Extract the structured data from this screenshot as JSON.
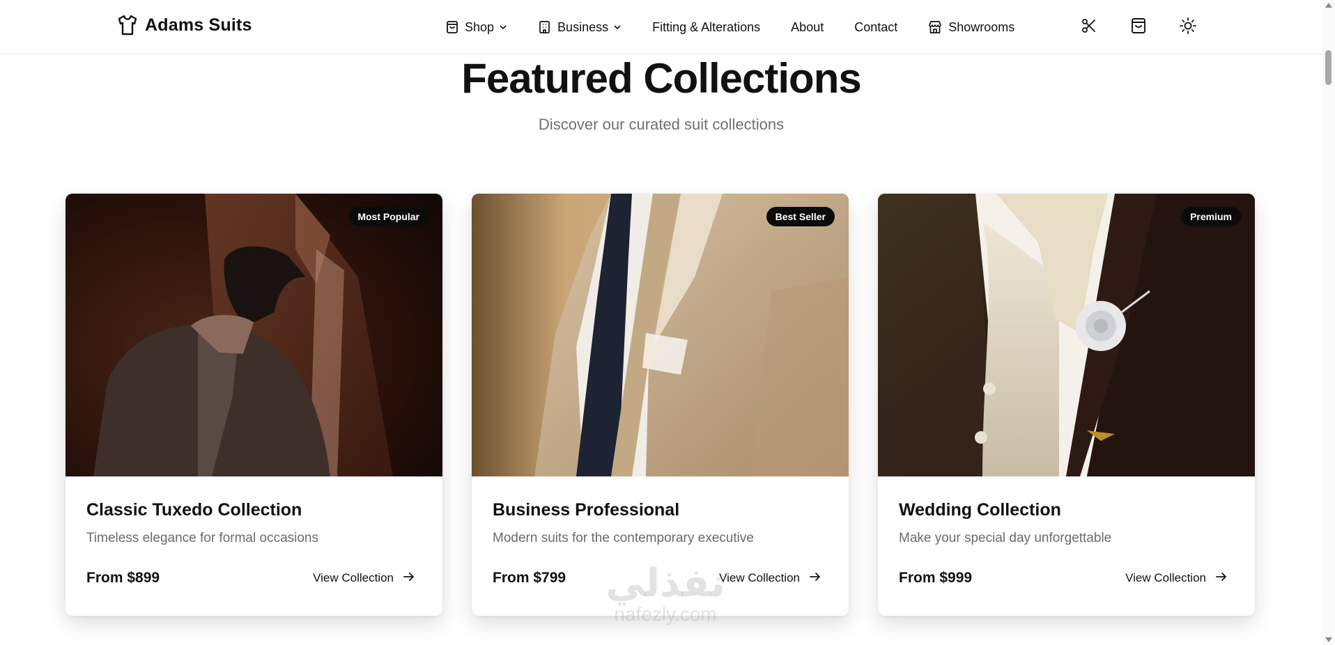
{
  "header": {
    "brand": "Adams Suits",
    "nav": [
      {
        "label": "Shop",
        "icon": "shopping-bag-icon",
        "dropdown": true
      },
      {
        "label": "Business",
        "icon": "building-icon",
        "dropdown": true
      },
      {
        "label": "Fitting & Alterations"
      },
      {
        "label": "About"
      },
      {
        "label": "Contact"
      },
      {
        "label": "Showrooms",
        "icon": "store-icon"
      }
    ],
    "actions": [
      "scissors-icon",
      "shopping-bag-icon",
      "sun-icon"
    ]
  },
  "section": {
    "title": "Featured Collections",
    "subtitle": "Discover our curated suit collections"
  },
  "cards": [
    {
      "badge": "Most Popular",
      "title": "Classic Tuxedo Collection",
      "description": "Timeless elegance for formal occasions",
      "price": "From $899",
      "link": "View Collection"
    },
    {
      "badge": "Best Seller",
      "title": "Business Professional",
      "description": "Modern suits for the contemporary executive",
      "price": "From $799",
      "link": "View Collection"
    },
    {
      "badge": "Premium",
      "title": "Wedding Collection",
      "description": "Make your special day unforgettable",
      "price": "From $999",
      "link": "View Collection"
    }
  ],
  "watermark": {
    "main": "نفذلي",
    "sub": "nafezly.com"
  },
  "colors": {
    "text": "#111111",
    "muted": "#6b6b6b",
    "badge_bg": "#0b0b0b",
    "divider": "#e6e6e6"
  }
}
